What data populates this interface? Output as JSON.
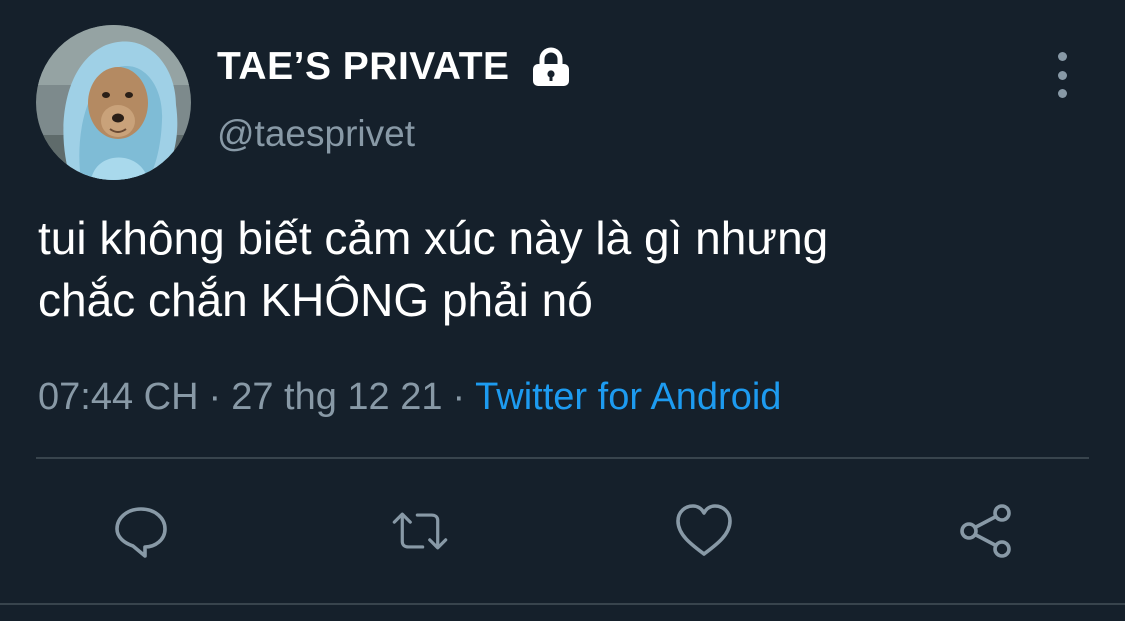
{
  "tweet": {
    "display_name": "TAE’S PRIVATE",
    "handle": "@taesprivet",
    "text_lines": [
      "tui không biết cảm xúc này là gì nhưng",
      "chắc chắn KHÔNG phải nó"
    ],
    "time": "07:44 CH",
    "separator": "·",
    "date": "27 thg 12 21",
    "source": "Twitter for Android"
  },
  "icons": {
    "lock": "lock-icon",
    "more": "more-vertical-icon",
    "reply": "reply-icon",
    "retweet": "retweet-icon",
    "like": "heart-icon",
    "share": "share-icon"
  },
  "colors": {
    "background": "#15202b",
    "text": "#ffffff",
    "secondary": "#8899a6",
    "link": "#1d9bf0",
    "divider": "#38444d"
  }
}
